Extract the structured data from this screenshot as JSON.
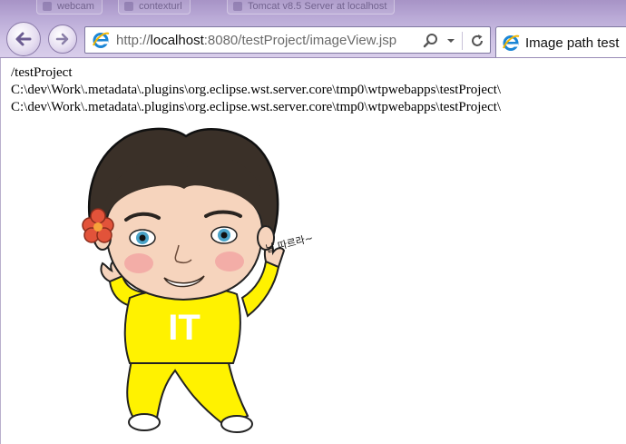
{
  "browser": {
    "background_tabs": [
      "webcam",
      "contexturl",
      "Tomcat v8.5 Server at localhost"
    ],
    "address_bar": {
      "url_prefix": "http://",
      "url_host": "localhost",
      "url_rest": ":8080/testProject/imageView.jsp"
    },
    "active_tab": {
      "title": "Image path test"
    },
    "accent_color": "#b9a9d6"
  },
  "page": {
    "output_lines": [
      "/testProject",
      "C:\\dev\\Work\\.metadata\\.plugins\\org.eclipse.wst.server.core\\tmp0\\wtpwebapps\\testProject\\",
      "C:\\dev\\Work\\.metadata\\.plugins\\org.eclipse.wst.server.core\\tmp0\\wtpwebapps\\testProject\\"
    ],
    "image": {
      "shirt_text": "IT",
      "speech_text": "날 따르라~",
      "shirt_color": "#fff200"
    }
  }
}
